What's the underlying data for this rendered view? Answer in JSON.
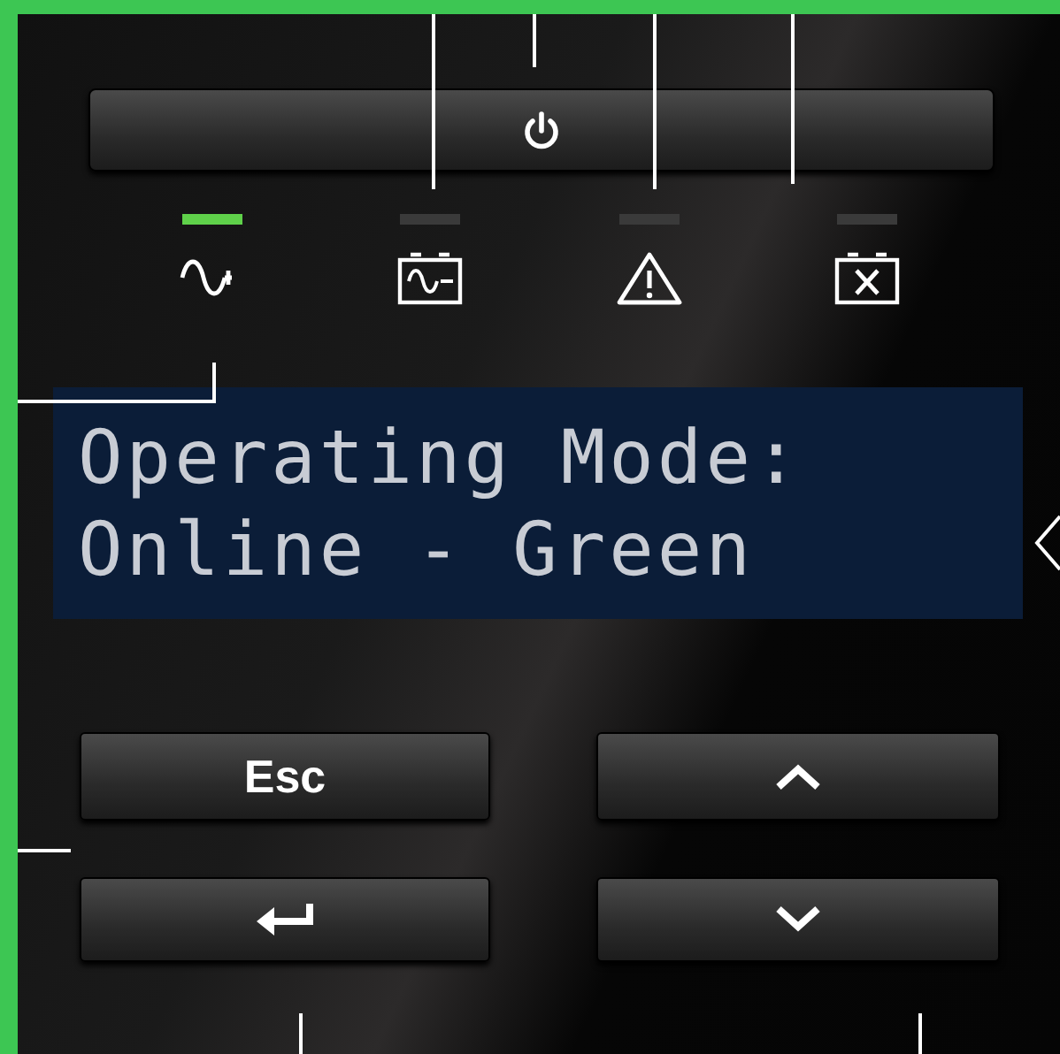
{
  "indicators": [
    {
      "kind": "online",
      "on": true
    },
    {
      "kind": "battery",
      "on": false
    },
    {
      "kind": "alarm",
      "on": false
    },
    {
      "kind": "replace-battery",
      "on": false
    }
  ],
  "display": {
    "lines": [
      "Operating Mode:",
      "Online - Green"
    ]
  },
  "buttons": [
    {
      "kind": "label",
      "label": "Esc"
    },
    {
      "kind": "up"
    },
    {
      "kind": "enter"
    },
    {
      "kind": "down"
    }
  ]
}
